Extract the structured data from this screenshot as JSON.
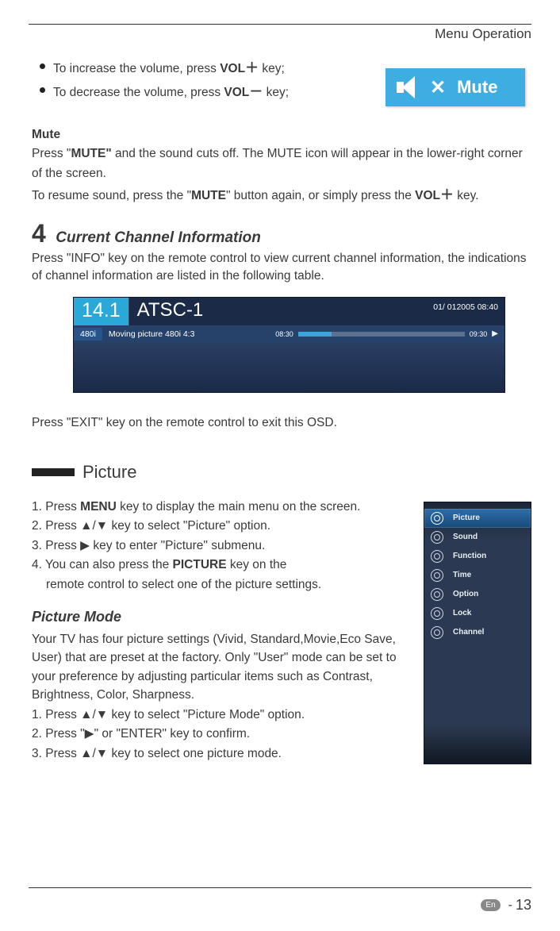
{
  "header": {
    "section_title": "Menu Operation"
  },
  "volume": {
    "increase_pre": "To increase the volume, press ",
    "increase_bold": "VOL",
    "increase_sym": "＋",
    "increase_post": " key;",
    "decrease_pre": "To decrease the volume, press ",
    "decrease_bold": "VOL",
    "decrease_sym": "－",
    "decrease_post": " key;"
  },
  "mute_badge": {
    "label": "Mute",
    "cross": "✕"
  },
  "mute_section": {
    "heading": "Mute",
    "p1a": "Press \"",
    "p1b": "MUTE\"",
    "p1c": " and the sound cuts off. The MUTE icon will appear in the lower-right corner of the screen.",
    "p2a": "To resume sound, press the \"",
    "p2b": "MUTE",
    "p2c": "\" button again, or simply press the ",
    "p2d": "VOL",
    "p2sym": "＋",
    "p2e": " key."
  },
  "section4": {
    "num": "4",
    "title": "Current Channel Information",
    "desc": "Press \"INFO\" key on the remote control to view current channel information, the indications of channel information are listed in the following table."
  },
  "osd": {
    "ch_num": "14.1",
    "ch_name": "ATSC-1",
    "datetime": "01/ 012005 08:40",
    "resolution": "480i",
    "program": "Moving picture 480i 4:3",
    "t_start": "08:30",
    "t_end": "09:30",
    "play": "▶"
  },
  "exit_line": "Press \"EXIT\" key on the remote control to exit this OSD.",
  "picture": {
    "heading": "Picture",
    "s1a": "1. Press ",
    "s1b": "MENU",
    "s1c": " key to display the main menu on the screen.",
    "s2": "2. Press ▲/▼ key to select \"Picture\" option.",
    "s3": "3. Press ▶ key to enter \"Picture\" submenu.",
    "s4a": "4. You can also press the ",
    "s4b": "PICTURE",
    "s4c": " key on the",
    "s4d": "remote control to select one of the picture settings.",
    "mode_heading": "Picture Mode",
    "mode_p1": "Your TV has four picture settings (Vivid, Standard,Movie,Eco Save, User) that are preset at the factory. Only \"User\" mode can be set to your preference by adjusting particular items such as Contrast, Brightness, Color, Sharpness.",
    "m1": "1. Press ▲/▼ key to select \"Picture Mode\" option.",
    "m2": "2. Press \"▶\" or \"ENTER\" key to confirm.",
    "m3": "3. Press ▲/▼ key to select one picture mode."
  },
  "menu": {
    "items": [
      {
        "label": "Picture",
        "selected": true
      },
      {
        "label": "Sound",
        "selected": false
      },
      {
        "label": "Function",
        "selected": false
      },
      {
        "label": "Time",
        "selected": false
      },
      {
        "label": "Option",
        "selected": false
      },
      {
        "label": "Lock",
        "selected": false
      },
      {
        "label": "Channel",
        "selected": false
      }
    ]
  },
  "footer": {
    "lang": "En",
    "dash": "-",
    "page": "13"
  }
}
